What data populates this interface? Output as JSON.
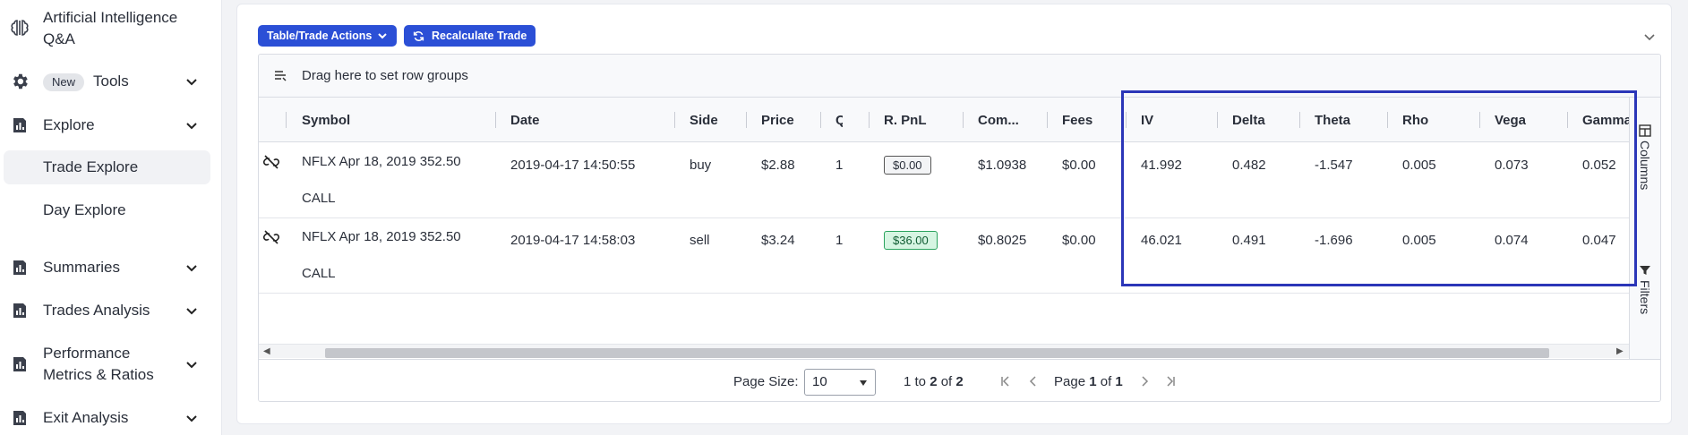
{
  "sidebar": {
    "items": [
      {
        "label": "Artificial Intelligence Q&A",
        "icon": "brain-icon"
      },
      {
        "label": "Tools",
        "badge": "New",
        "icon": "gear-icon"
      },
      {
        "label": "Explore",
        "icon": "chart-bar-icon"
      },
      {
        "label": "Summaries",
        "icon": "chart-bar-icon"
      },
      {
        "label": "Trades Analysis",
        "icon": "chart-bar-icon"
      },
      {
        "label": "Performance Metrics & Ratios",
        "icon": "chart-bar-icon"
      },
      {
        "label": "Exit Analysis",
        "icon": "chart-bar-icon"
      }
    ],
    "explore_sub": [
      {
        "label": "Trade Explore",
        "active": true
      },
      {
        "label": "Day Explore",
        "active": false
      }
    ]
  },
  "toolbar": {
    "actions_label": "Table/Trade Actions",
    "recalc_label": "Recalculate Trade"
  },
  "grid": {
    "group_hint": "Drag here to set row groups",
    "columns": [
      "Symbol",
      "Date",
      "Side",
      "Price",
      "Q",
      "R. PnL",
      "Com...",
      "Fees",
      "IV",
      "Delta",
      "Theta",
      "Rho",
      "Vega",
      "Gamma"
    ],
    "rows": [
      {
        "symbol_line1": "NFLX Apr 18, 2019 352.50",
        "symbol_line2": "CALL",
        "date": "2019-04-17 14:50:55",
        "side": "buy",
        "price": "$2.88",
        "qty": "1",
        "rpnl": "$0.00",
        "commission": "$1.0938",
        "fees": "$0.00",
        "iv": "41.992",
        "delta": "0.482",
        "theta": "-1.547",
        "rho": "0.005",
        "vega": "0.073",
        "gamma": "0.052"
      },
      {
        "symbol_line1": "NFLX Apr 18, 2019 352.50",
        "symbol_line2": "CALL",
        "date": "2019-04-17 14:58:03",
        "side": "sell",
        "price": "$3.24",
        "qty": "1",
        "rpnl": "$36.00",
        "commission": "$0.8025",
        "fees": "$0.00",
        "iv": "46.021",
        "delta": "0.491",
        "theta": "-1.696",
        "rho": "0.005",
        "vega": "0.074",
        "gamma": "0.047"
      }
    ],
    "side_tabs": {
      "columns": "Columns",
      "filters": "Filters"
    }
  },
  "pagination": {
    "page_size_label": "Page Size:",
    "page_size_value": "10",
    "range_from": "1",
    "range_to": "2",
    "total": "2",
    "page_label": "Page",
    "page_current": "1",
    "page_total": "1",
    "to_word": "to",
    "of_word": "of"
  },
  "colors": {
    "accent": "#2b4fd6",
    "highlight": "#2b36b8",
    "positive": "#2aa35d"
  }
}
